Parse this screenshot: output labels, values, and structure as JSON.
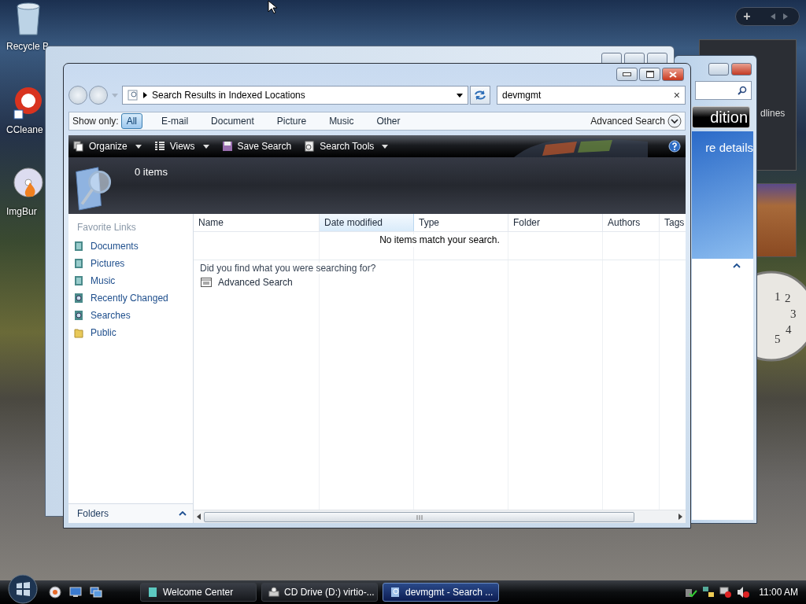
{
  "desktop": {
    "icons": [
      {
        "label": "Recycle B",
        "kind": "bin"
      },
      {
        "label": "CCleane",
        "kind": "cleaner"
      },
      {
        "label": "ImgBur",
        "kind": "disc"
      }
    ]
  },
  "gadgets": {
    "add_label": "+",
    "headlines_text": "dlines",
    "clock_numerals": [
      "1",
      "2",
      "3",
      "4",
      "5"
    ]
  },
  "welcome_window": {
    "banner": "dition",
    "link": "re details"
  },
  "window": {
    "address": "Search Results in Indexed Locations",
    "search": {
      "value": "devmgmt",
      "clear": "×"
    },
    "filter": {
      "label": "Show only:",
      "tabs": [
        {
          "label": "All",
          "selected": true
        },
        {
          "label": "E-mail",
          "selected": false
        },
        {
          "label": "Document",
          "selected": false
        },
        {
          "label": "Picture",
          "selected": false
        },
        {
          "label": "Music",
          "selected": false
        },
        {
          "label": "Other",
          "selected": false
        }
      ],
      "advanced": "Advanced Search"
    },
    "toolbar": {
      "items": [
        {
          "label": "Organize",
          "kind": "organize",
          "dropdown": true
        },
        {
          "label": "Views",
          "kind": "views",
          "dropdown": true
        },
        {
          "label": "Save Search",
          "kind": "save",
          "dropdown": false
        },
        {
          "label": "Search Tools",
          "kind": "tools",
          "dropdown": true
        }
      ]
    },
    "details": {
      "count": "0 items"
    },
    "nav": {
      "heading": "Favorite Links",
      "items": [
        {
          "label": "Documents",
          "kind": "documents"
        },
        {
          "label": "Pictures",
          "kind": "pictures"
        },
        {
          "label": "Music",
          "kind": "music"
        },
        {
          "label": "Recently Changed",
          "kind": "recent"
        },
        {
          "label": "Searches",
          "kind": "searches"
        },
        {
          "label": "Public",
          "kind": "folder"
        }
      ],
      "folders": "Folders"
    },
    "columns": [
      {
        "label": "Name",
        "selected": false
      },
      {
        "label": "Date modified",
        "selected": true
      },
      {
        "label": "Type",
        "selected": false
      },
      {
        "label": "Folder",
        "selected": false
      },
      {
        "label": "Authors",
        "selected": false
      },
      {
        "label": "Tags",
        "selected": false
      }
    ],
    "empty_message": "No items match your search.",
    "group": {
      "heading": "Did you find what you were searching for?",
      "items": [
        "Advanced Search"
      ]
    }
  },
  "taskbar": {
    "tasks": [
      {
        "label": "Welcome Center",
        "kind": "welcome",
        "selected": false
      },
      {
        "label": "CD Drive (D:) virtio-...",
        "kind": "drive",
        "selected": false
      },
      {
        "label": "devmgmt - Search ...",
        "kind": "search",
        "selected": true
      }
    ],
    "clock": "11:00 AM"
  }
}
